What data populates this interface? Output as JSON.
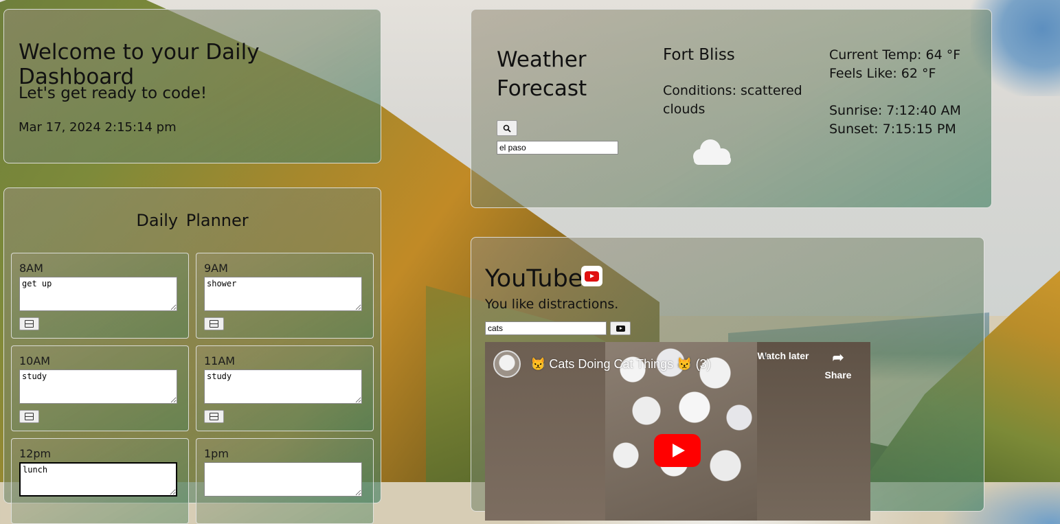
{
  "welcome": {
    "title": "Welcome to your Daily Dashboard",
    "subtitle": "Let's get ready to code!",
    "datetime": "Mar 17, 2024 2:15:14 pm"
  },
  "planner": {
    "title": "Daily Planner",
    "slots": [
      {
        "label": "8AM",
        "value": "get up"
      },
      {
        "label": "9AM",
        "value": "shower"
      },
      {
        "label": "10AM",
        "value": "study"
      },
      {
        "label": "11AM",
        "value": "study"
      },
      {
        "label": "12pm",
        "value": "lunch"
      },
      {
        "label": "1pm",
        "value": ""
      }
    ],
    "save_icon": "save-icon"
  },
  "weather": {
    "title": "Weather Forecast",
    "search_icon": "magnifier-icon",
    "city_input": "el paso",
    "city": "Fort Bliss",
    "conditions": "Conditions: scattered clouds",
    "weather_icon": "cloud-icon",
    "current_temp": "Current Temp: 64 °F",
    "feels_like": "Feels Like: 62 °F",
    "sunrise": "Sunrise: 7:12:40 AM",
    "sunset": "Sunset: 7:15:15 PM"
  },
  "youtube": {
    "title": "YouTube",
    "logo_icon": "youtube-logo-icon",
    "subtitle": "You like distractions.",
    "search_value": "cats",
    "search_icon": "youtube-play-icon",
    "video": {
      "title": "😾 Cats Doing Cat Things 😾  (3)",
      "watch_later": "Watch later",
      "share": "Share"
    }
  },
  "colors": {
    "panel_border": "#ebebeb",
    "youtube_red": "#ff0000"
  }
}
